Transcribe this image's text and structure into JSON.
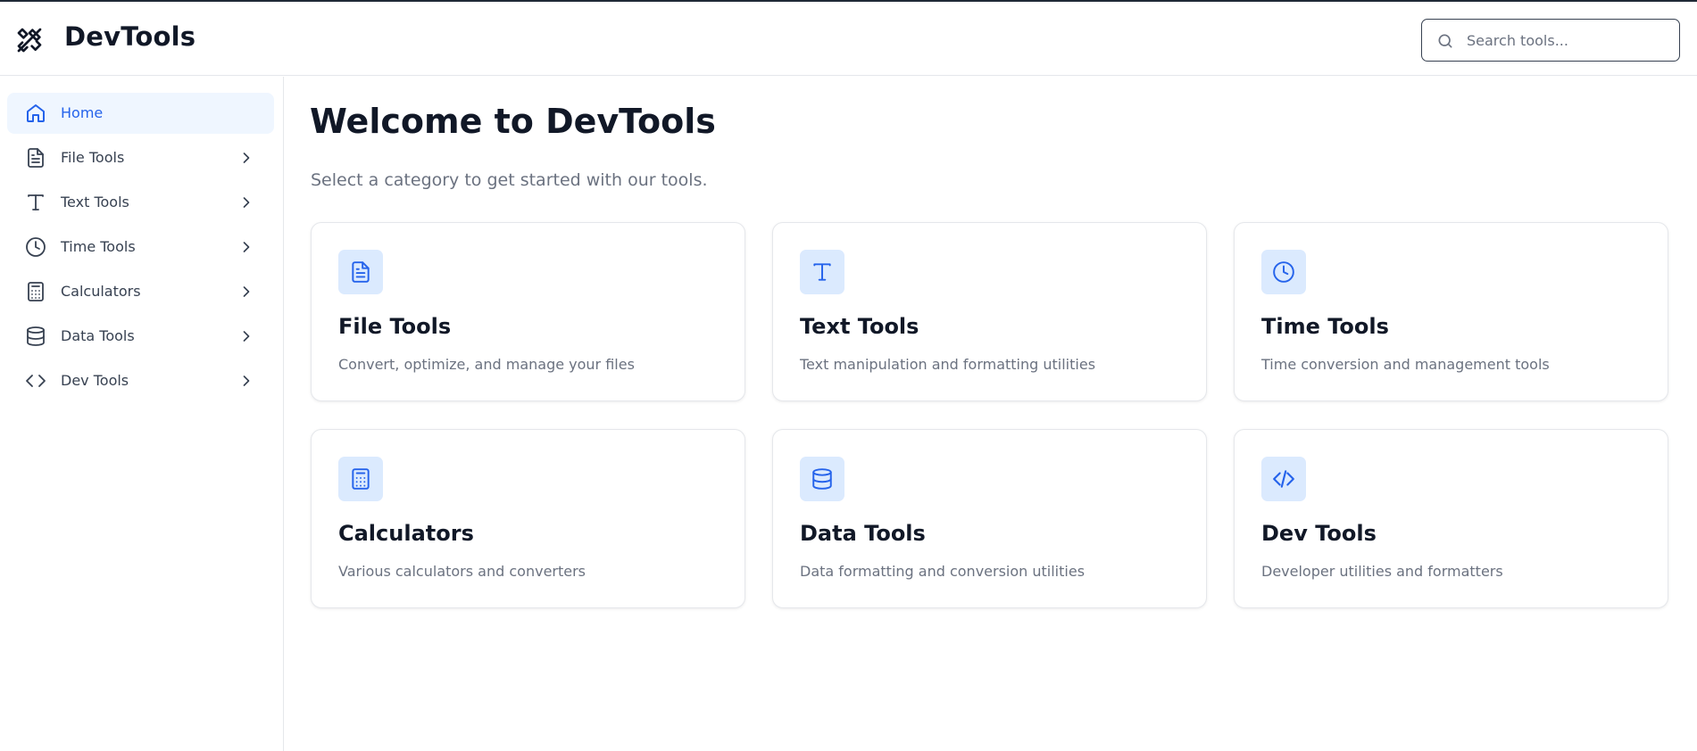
{
  "app": {
    "title": "DevTools",
    "logo_icon": "tools-icon"
  },
  "search": {
    "placeholder": "Search tools...",
    "value": "",
    "icon": "search-icon"
  },
  "sidebar": {
    "items": [
      {
        "label": "Home",
        "icon": "home-icon",
        "active": true,
        "has_children": false
      },
      {
        "label": "File Tools",
        "icon": "file-icon",
        "active": false,
        "has_children": true
      },
      {
        "label": "Text Tools",
        "icon": "text-icon",
        "active": false,
        "has_children": true
      },
      {
        "label": "Time Tools",
        "icon": "clock-icon",
        "active": false,
        "has_children": true
      },
      {
        "label": "Calculators",
        "icon": "calculator-icon",
        "active": false,
        "has_children": true
      },
      {
        "label": "Data Tools",
        "icon": "database-icon",
        "active": false,
        "has_children": true
      },
      {
        "label": "Dev Tools",
        "icon": "code-icon",
        "active": false,
        "has_children": true
      }
    ]
  },
  "main": {
    "title": "Welcome to DevTools",
    "subtitle": "Select a category to get started with our tools.",
    "cards": [
      {
        "title": "File Tools",
        "description": "Convert, optimize, and manage your files",
        "icon": "file-icon"
      },
      {
        "title": "Text Tools",
        "description": "Text manipulation and formatting utilities",
        "icon": "text-icon"
      },
      {
        "title": "Time Tools",
        "description": "Time conversion and management tools",
        "icon": "clock-icon"
      },
      {
        "title": "Calculators",
        "description": "Various calculators and converters",
        "icon": "calculator-icon"
      },
      {
        "title": "Data Tools",
        "description": "Data formatting and conversion utilities",
        "icon": "database-icon"
      },
      {
        "title": "Dev Tools",
        "description": "Developer utilities and formatters",
        "icon": "code-icon"
      }
    ]
  },
  "colors": {
    "accent": "#2563eb",
    "accent_light": "#dbeafe",
    "active_bg": "#eff6ff",
    "text_muted": "#6b7280",
    "border": "#e5e7eb"
  }
}
